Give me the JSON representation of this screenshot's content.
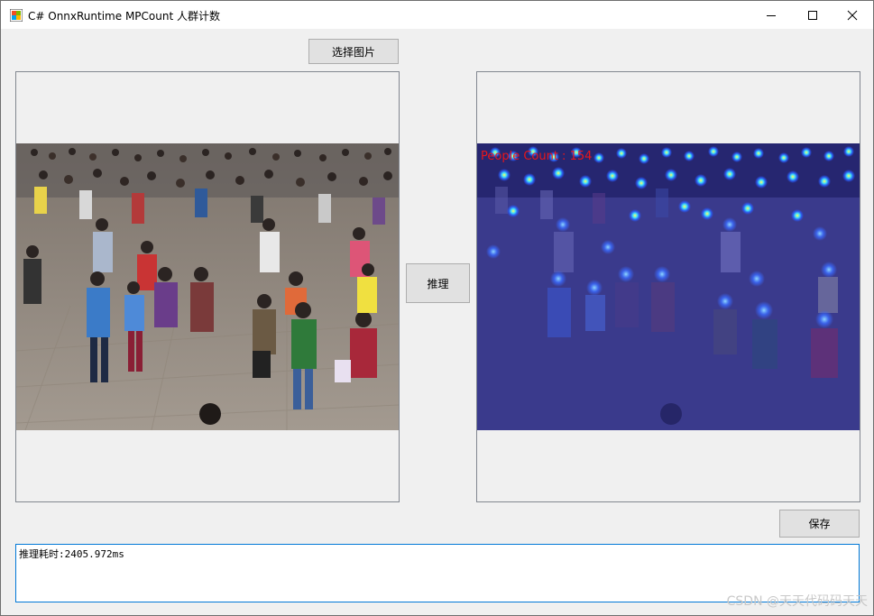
{
  "window": {
    "title": "C# OnnxRuntime MPCount 人群计数",
    "minimize_icon": "minimize-icon",
    "maximize_icon": "maximize-icon",
    "close_icon": "close-icon"
  },
  "toolbar": {
    "select_image_label": "选择图片",
    "infer_label": "推理",
    "save_label": "保存"
  },
  "result": {
    "people_count_text": "People Count : 154"
  },
  "output": {
    "log_text": "推理耗时:2405.972ms"
  },
  "watermark": "CSDN @天天代码码天天",
  "colors": {
    "window_bg": "#f0f0f0",
    "button_bg": "#e1e1e1",
    "textarea_focus_border": "#0078d7",
    "count_text": "#e8161b",
    "overlay_tint": "#20208a"
  }
}
